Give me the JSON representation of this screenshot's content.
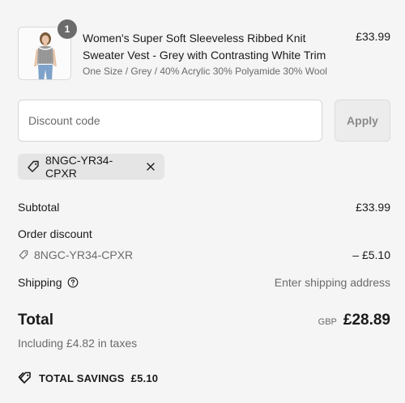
{
  "line_item": {
    "quantity": "1",
    "title": "Women's Super Soft Sleeveless Ribbed Knit Sweater Vest - Grey with Contrasting White Trim",
    "variant": "One Size / Grey / 40% Acrylic 30% Polyamide 30% Wool",
    "price": "£33.99"
  },
  "discount": {
    "placeholder": "Discount code",
    "apply_label": "Apply",
    "applied_code": "8NGC-YR34-CPXR"
  },
  "summary": {
    "subtotal_label": "Subtotal",
    "subtotal_value": "£33.99",
    "order_discount_label": "Order discount",
    "order_discount_code": "8NGC-YR34-CPXR",
    "order_discount_value": "– £5.10",
    "shipping_label": "Shipping",
    "shipping_value": "Enter shipping address",
    "total_label": "Total",
    "currency": "GBP",
    "total_value": "£28.89",
    "tax_note": "Including £4.82 in taxes",
    "savings_label": "TOTAL SAVINGS",
    "savings_value": "£5.10"
  },
  "colors": {
    "background": "#f5f5f5",
    "text": "#1a1a1a",
    "muted": "#6b6b6b",
    "chip": "#e5e5e5",
    "badge": "#6b6b6b"
  },
  "icons": [
    "tag-icon",
    "close-icon",
    "info-icon",
    "savings-tag-icon"
  ]
}
